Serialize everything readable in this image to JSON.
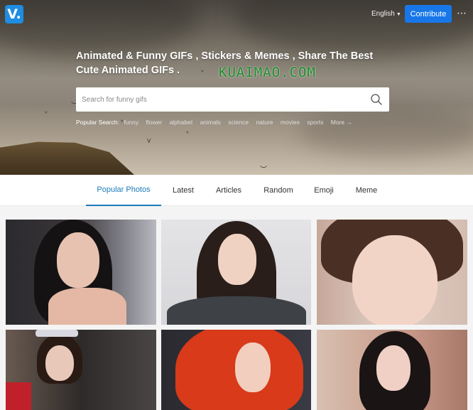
{
  "header": {
    "logo_text": "V.",
    "language": "English",
    "contribute_label": "Contribute",
    "more_icon": "⋯"
  },
  "hero": {
    "headline": "Animated & Funny GIFs , Stickers & Memes , Share The Best Cute Animated GIFs .",
    "watermark": "KUAIMAO.COM",
    "search_placeholder": "Search for funny gifs",
    "popular_label": "Popular Search:",
    "popular_tags": [
      "funny",
      "flower",
      "alphabet",
      "animals",
      "science",
      "nature",
      "movies",
      "sports"
    ],
    "more_link": "More →"
  },
  "nav": {
    "tabs": [
      "Popular Photos",
      "Latest",
      "Articles",
      "Random",
      "Emoji",
      "Meme"
    ],
    "active_index": 0
  },
  "colors": {
    "accent": "#1a7bb8",
    "contribute_bg": "#1877e8",
    "logo_bg": "#1e8de2"
  },
  "icons": {
    "logo": "v-logo-icon",
    "search": "search-icon",
    "more": "more-dots-icon"
  }
}
